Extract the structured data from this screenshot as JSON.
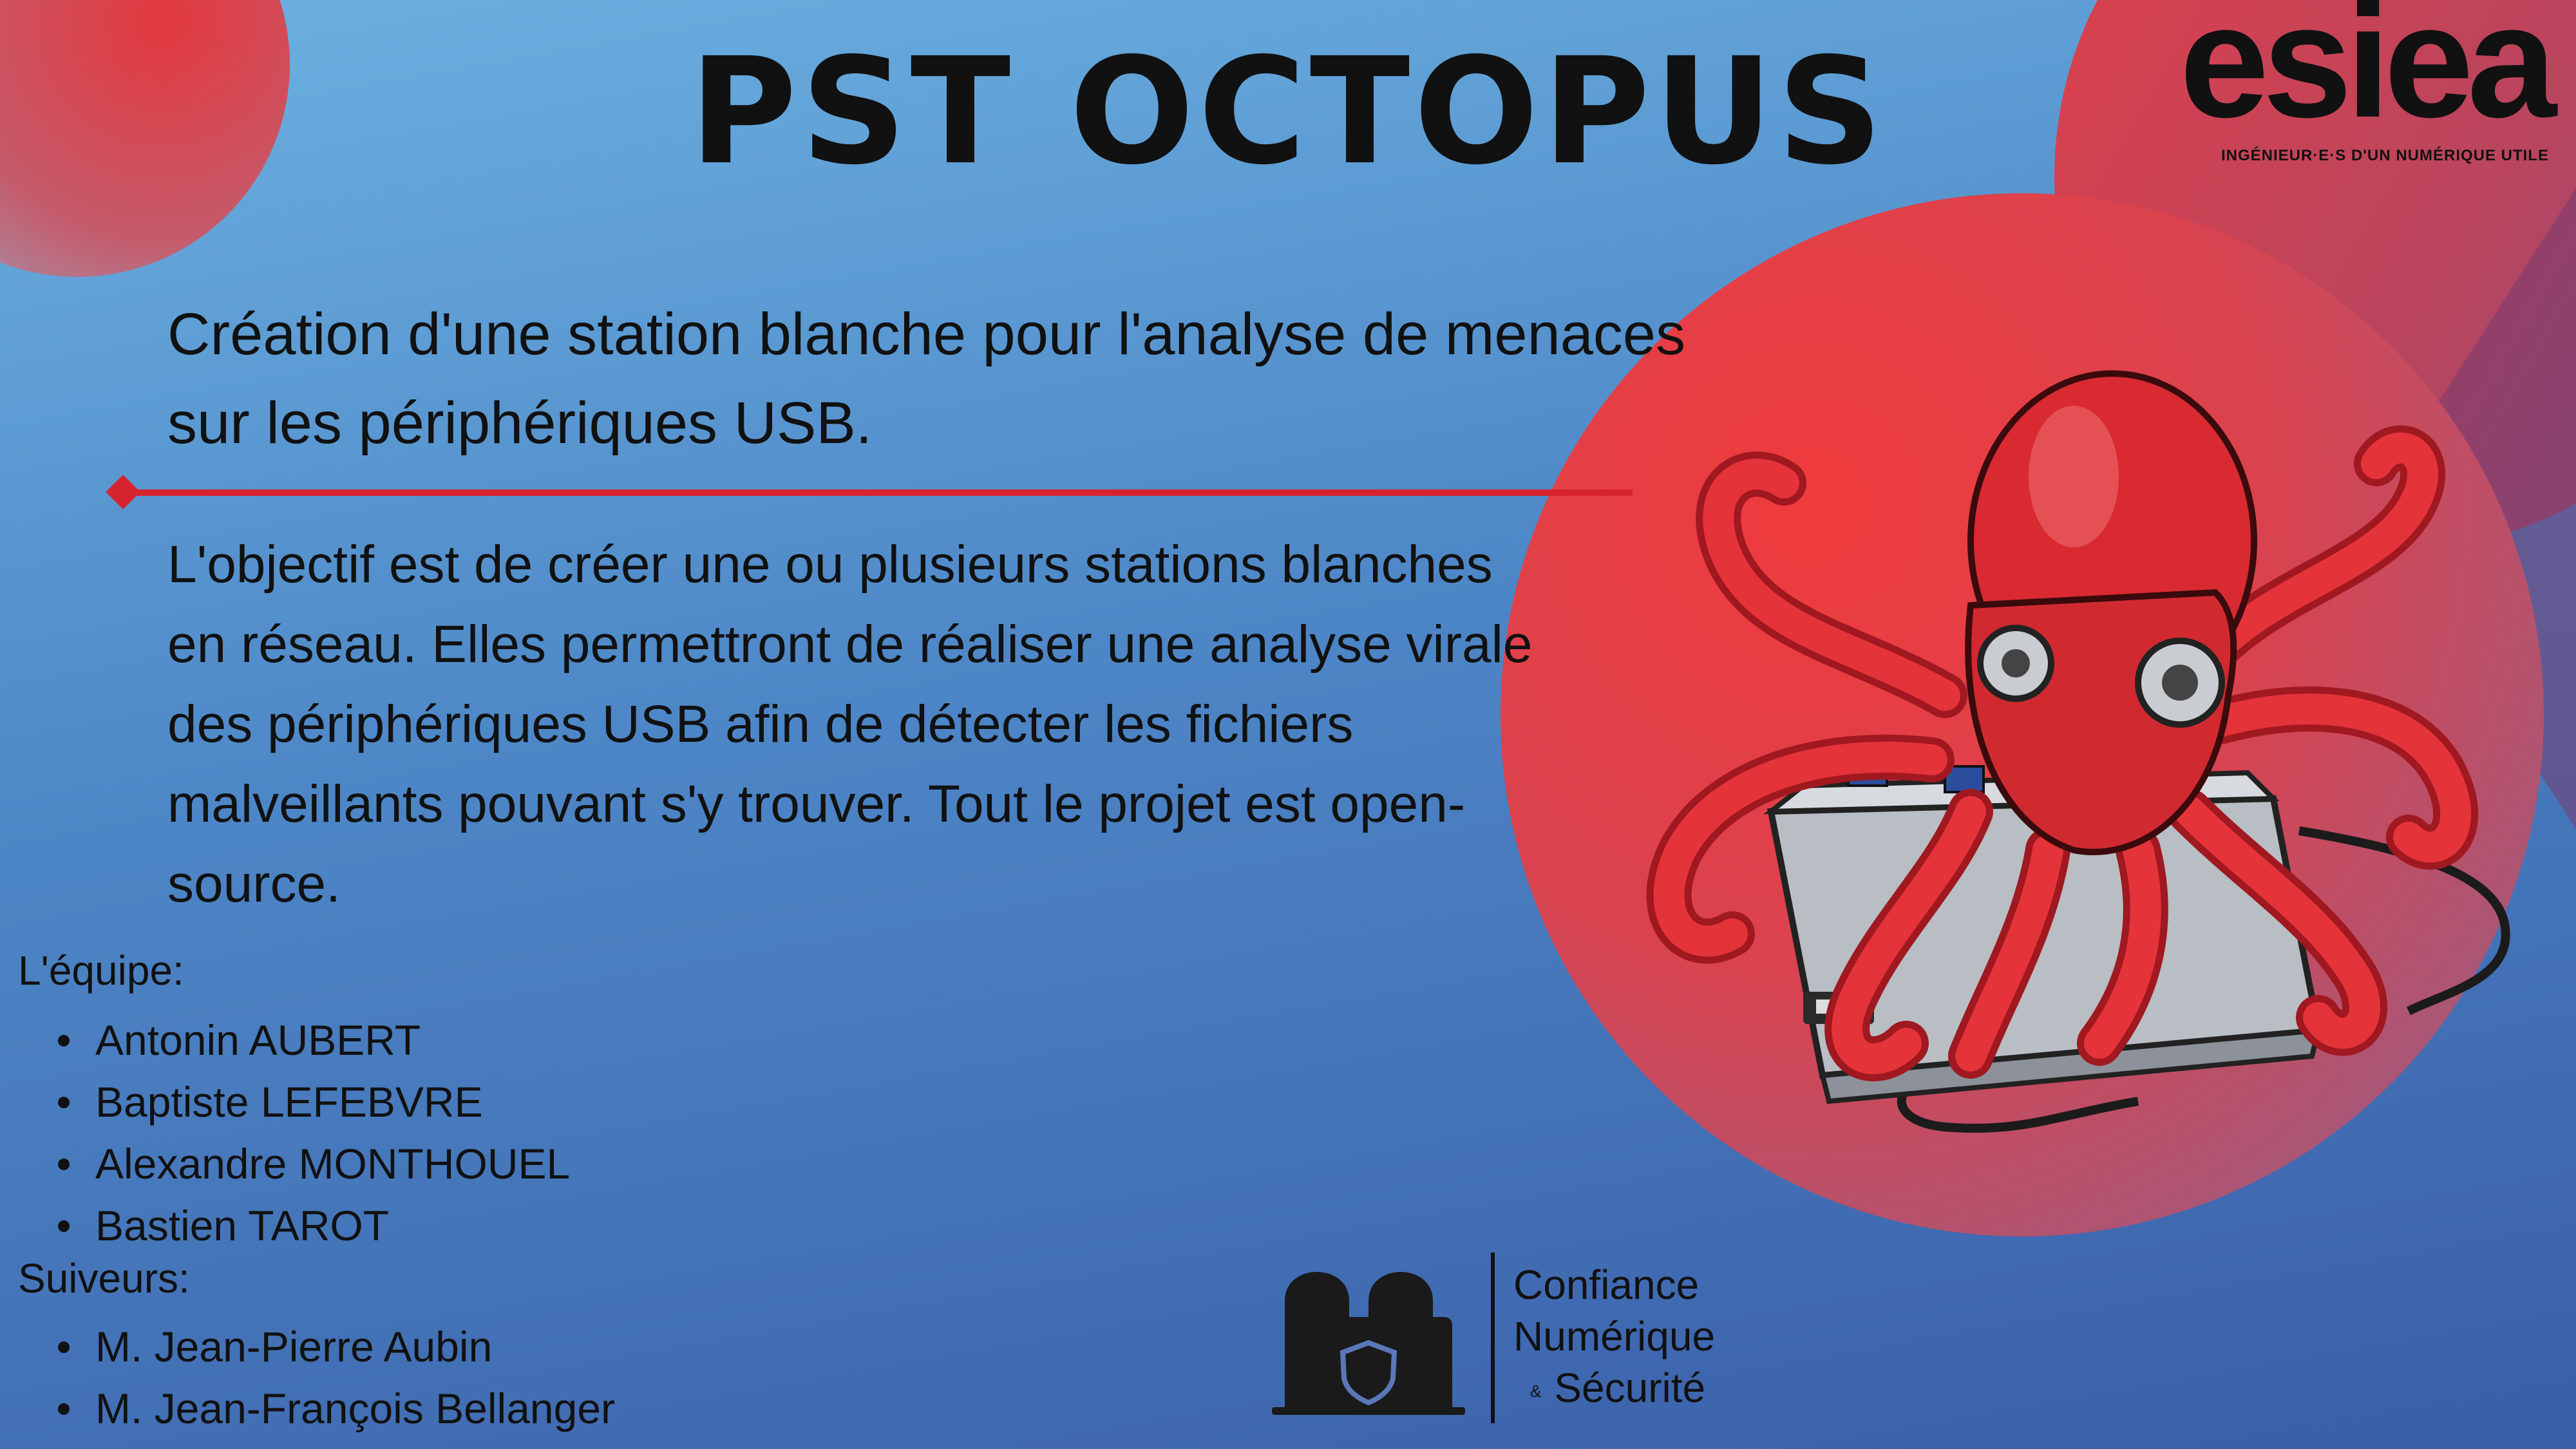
{
  "title": "PST OCTOPUS",
  "logo": {
    "wordmark": "esiea",
    "tagline": "INGÉNIEUR·E·S D'UN NUMÉRIQUE UTILE"
  },
  "intro": "Création d'une station blanche pour l'analyse de menaces sur les périphériques USB.",
  "objective": "L'objectif est de créer une ou plusieurs stations blanches en réseau. Elles permettront de réaliser une analyse virale des périphériques USB afin de détecter les fichiers malveillants pouvant s'y trouver. Tout le projet est open-source.",
  "team": {
    "label": "L'équipe:",
    "members": [
      "Antonin AUBERT",
      "Baptiste LEFEBVRE",
      "Alexandre MONTHOUEL",
      "Bastien TAROT"
    ]
  },
  "followers": {
    "label": "Suiveurs:",
    "members": [
      "M. Jean-Pierre Aubin",
      "M. Jean-François Bellanger"
    ]
  },
  "cns": {
    "line1": "Confiance",
    "line2": "Numérique",
    "amp": "&",
    "line3": "Sécurité"
  },
  "colors": {
    "accent_red": "#d6242f",
    "background_top": "#6cb1e1",
    "background_bottom": "#3a5ea8"
  },
  "icons": [
    "octopus-illustration",
    "usb-hub-illustration",
    "team-shield-icon"
  ]
}
